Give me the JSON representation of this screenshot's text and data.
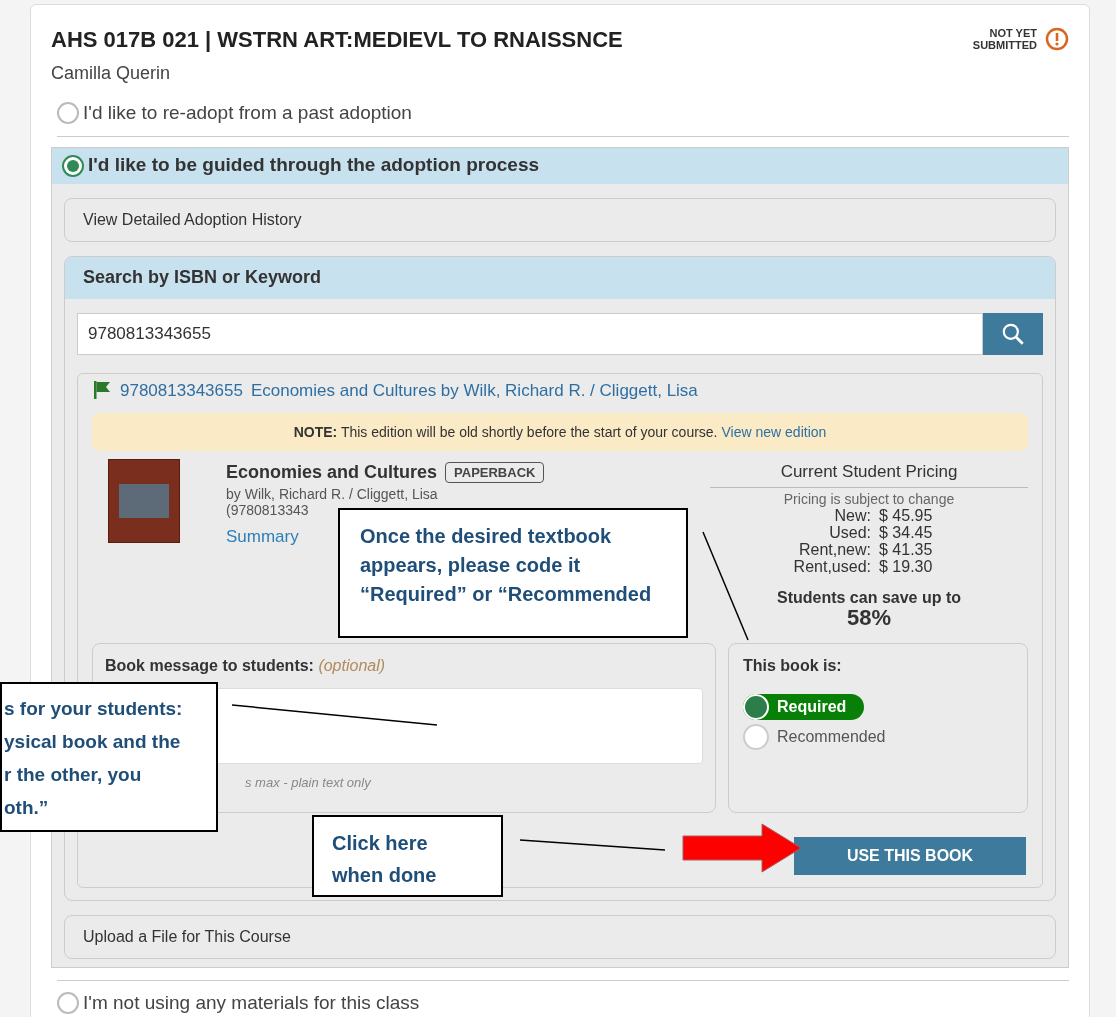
{
  "course": {
    "title": "AHS 017B 021 | WSTRN ART:MEDIEVL TO RNAISSNCE",
    "instructor": "Camilla Querin",
    "status_lines": [
      "NOT YET",
      "SUBMITTED"
    ]
  },
  "options": [
    {
      "label": "I'd like to re-adopt from a past adoption",
      "selected": false
    },
    {
      "label": "I'd like to be guided through the adoption process",
      "selected": true
    },
    {
      "label": "I'm not using any materials for this class",
      "selected": false
    }
  ],
  "guided": {
    "history": "View Detailed Adoption History",
    "search_header": "Search by ISBN or Keyword",
    "search_value": "9780813343655",
    "result": {
      "isbn": "9780813343655",
      "link": "Economies and Cultures by Wilk, Richard R. / Cliggett, Lisa"
    },
    "note": {
      "label": "NOTE:",
      "text": "This edition will be old shortly before the start of your course.",
      "link": "View new edition"
    },
    "book": {
      "title": "Economies and Cultures",
      "format": "PAPERBACK",
      "author": "by Wilk, Richard R. / Cliggett, Lisa",
      "isbn": "(9780813343",
      "summary": "Summary"
    },
    "pricing": {
      "title": "Current Student Pricing",
      "subtitle": "Pricing is subject to change",
      "rows": [
        {
          "label": "New:",
          "value": "$ 45.95"
        },
        {
          "label": "Used:",
          "value": "$ 34.45"
        },
        {
          "label": "Rent,new:",
          "value": "$ 41.35"
        },
        {
          "label": "Rent,used:",
          "value": "$ 19.30"
        }
      ],
      "savings": "Students can save up to",
      "percent": "58%"
    },
    "message": {
      "label": "Book message to students:",
      "optional": "(optional)",
      "hint": "s max - plain text only"
    },
    "designation": {
      "label": "This book is:",
      "options": [
        {
          "label": "Required",
          "selected": true
        },
        {
          "label": "Recommended",
          "selected": false
        }
      ]
    },
    "button": "USE THIS BOOK",
    "upload": "Upload a File for This Course"
  },
  "callouts": [
    {
      "lines": [
        "Once the desired textbook",
        "appears, please code it",
        "“Required” or “Recommended"
      ]
    },
    {
      "lines": [
        "s for your students:",
        "ysical book and the",
        "r the other, you",
        "oth.”"
      ]
    },
    {
      "lines": [
        "Click here",
        "when done"
      ]
    }
  ]
}
